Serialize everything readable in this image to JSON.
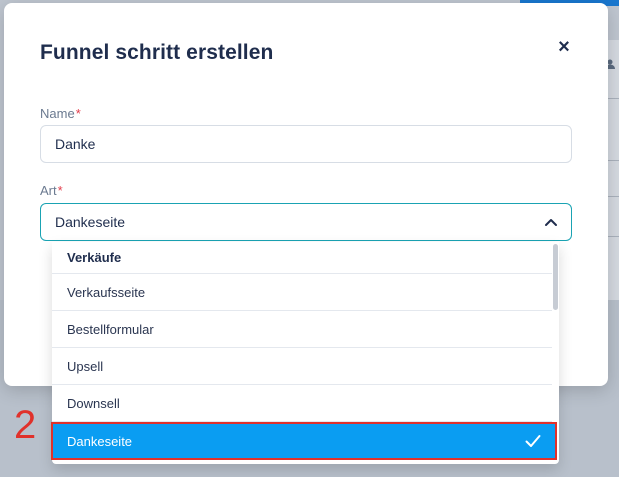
{
  "modal": {
    "title": "Funnel schritt erstellen",
    "close_label": "×"
  },
  "form": {
    "name_label": "Name",
    "name_required": "*",
    "name_value": "Danke",
    "type_label": "Art",
    "type_required": "*",
    "type_value": "Dankeseite"
  },
  "dropdown": {
    "group_label": "Verkäufe",
    "options": [
      {
        "label": "Verkaufsseite"
      },
      {
        "label": "Bestellformular"
      },
      {
        "label": "Upsell"
      },
      {
        "label": "Downsell"
      },
      {
        "label": "Dankeseite",
        "selected": true
      }
    ]
  },
  "annotation": {
    "step_number": "2",
    "color": "#e0312b"
  },
  "colors": {
    "accent": "#0a9df2",
    "focus_border": "#1aa3b3",
    "title": "#1f2d4d",
    "required": "#e23b4a"
  },
  "icons": {
    "close": "close-icon",
    "chevron": "chevron-up-icon",
    "check": "check-icon"
  }
}
